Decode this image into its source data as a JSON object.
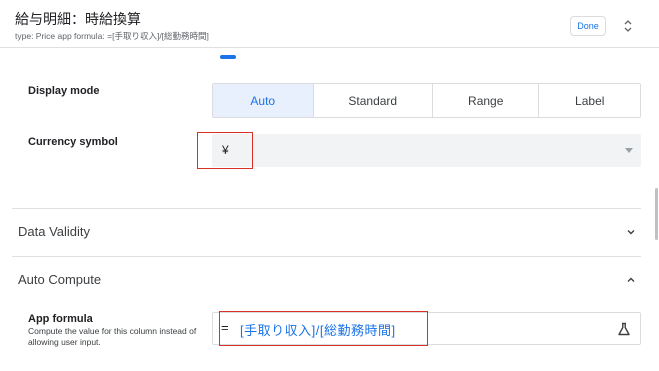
{
  "header": {
    "title": "給与明細：時給換算",
    "subtitle": "type: Price   app formula: =[手取り収入]/[総勤務時間]",
    "done_label": "Done",
    "updown_icon": "unfold-icon"
  },
  "display_mode": {
    "label": "Display mode",
    "options": [
      "Auto",
      "Standard",
      "Range",
      "Label"
    ],
    "selected": "Auto"
  },
  "currency": {
    "label": "Currency symbol",
    "value": "¥"
  },
  "sections": {
    "data_validity": {
      "title": "Data Validity",
      "expanded": false
    },
    "auto_compute": {
      "title": "Auto Compute",
      "expanded": true
    }
  },
  "app_formula": {
    "label": "App formula",
    "help": "Compute the value for this column instead of allowing user input.",
    "equals": "=",
    "value": "[手取り収入]/[総勤務時間]",
    "icon": "flask-icon"
  },
  "colors": {
    "accent": "#1a73e8",
    "selected_bg": "#e8f0fe",
    "highlight_red": "#d93025",
    "field_bg": "#f1f3f4"
  }
}
